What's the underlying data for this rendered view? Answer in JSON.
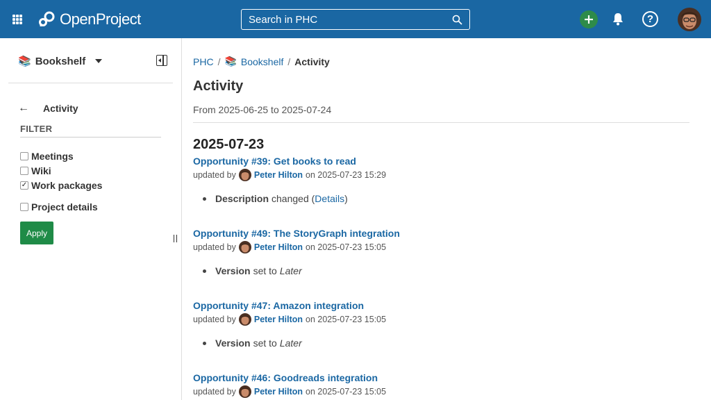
{
  "header": {
    "brand": "OpenProject",
    "search_placeholder": "Search in PHC"
  },
  "sidebar": {
    "project": "Bookshelf",
    "back_title": "Activity",
    "filter_title": "FILTER",
    "filters": [
      {
        "label": "Meetings",
        "checked": false
      },
      {
        "label": "Wiki",
        "checked": false
      },
      {
        "label": "Work packages",
        "checked": true
      },
      {
        "label": "Project details",
        "checked": false
      }
    ],
    "apply_label": "Apply"
  },
  "main": {
    "breadcrumb": {
      "root": "PHC",
      "project": "Bookshelf",
      "current": "Activity"
    },
    "title": "Activity",
    "range": "From 2025-06-25 to 2025-07-24",
    "day": "2025-07-23",
    "entries": [
      {
        "title": "Opportunity #39: Get books to read",
        "prefix": "updated by",
        "user": "Peter Hilton",
        "when": "on 2025-07-23 15:29",
        "field": "Description",
        "change": "changed (",
        "link": "Details",
        "suffix": ")"
      },
      {
        "title": "Opportunity #49: The StoryGraph integration",
        "prefix": "updated by",
        "user": "Peter Hilton",
        "when": "on 2025-07-23 15:05",
        "field": "Version",
        "change": "set to",
        "value": "Later"
      },
      {
        "title": "Opportunity #47: Amazon integration",
        "prefix": "updated by",
        "user": "Peter Hilton",
        "when": "on 2025-07-23 15:05",
        "field": "Version",
        "change": "set to",
        "value": "Later"
      },
      {
        "title": "Opportunity #46: Goodreads integration",
        "prefix": "updated by",
        "user": "Peter Hilton",
        "when": "on 2025-07-23 15:05"
      }
    ]
  },
  "colors": {
    "header": "#1a67a3",
    "link": "#1a67a3",
    "create": "#2e8b4a",
    "apply": "#1f8b47"
  }
}
